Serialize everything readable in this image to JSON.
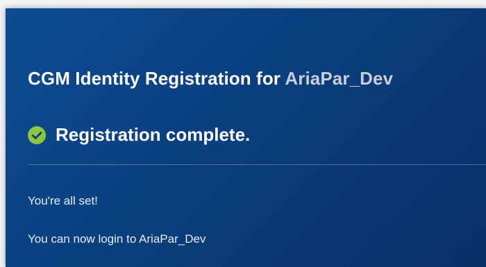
{
  "header": {
    "title_prefix": "CGM Identity Registration for",
    "app_name": "AriaPar_Dev"
  },
  "status": {
    "icon": "check-circle-icon",
    "text": "Registration complete.",
    "color": "#8dc63f"
  },
  "messages": {
    "line1": "You're all set!",
    "line2": "You can now login to AriaPar_Dev"
  },
  "theme": {
    "panel_color": "#0a3f7f",
    "accent": "#8dc63f"
  }
}
